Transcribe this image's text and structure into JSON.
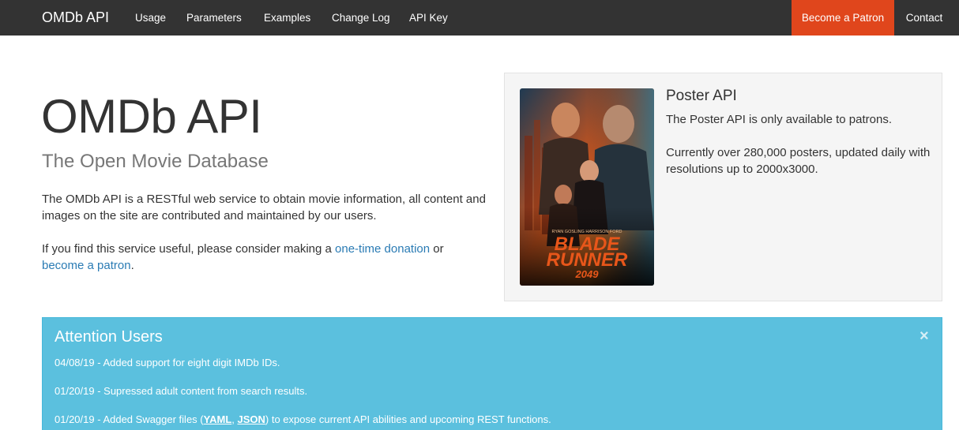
{
  "navbar": {
    "brand": "OMDb API",
    "links": [
      "Usage",
      "Parameters",
      "Examples",
      "Change Log",
      "API Key"
    ],
    "patron_button": "Become a Patron",
    "contact": "Contact",
    "colors": {
      "background": "#333333",
      "patron": "#e0461c"
    }
  },
  "hero": {
    "title": "OMDb API",
    "subtitle": "The Open Movie Database",
    "paragraph1": "The OMDb API is a RESTful web service to obtain movie information, all content and images on the site are contributed and maintained by our users.",
    "paragraph2_prefix": "If you find this service useful, please consider making a ",
    "donation_link": "one-time donation",
    "paragraph2_middle": " or",
    "patron_link": "become a patron",
    "paragraph2_suffix": "."
  },
  "poster": {
    "heading": "Poster API",
    "line1": "The Poster API is only available to patrons.",
    "line2": "Currently over 280,000 posters, updated daily with resolutions up to 2000x3000.",
    "image": {
      "actors": "RYAN GOSLING    HARRISON FORD",
      "title_line1": "BLADE",
      "title_line2": "RUNNER",
      "title_line3": "2049"
    }
  },
  "alert": {
    "title": "Attention Users",
    "close": "×",
    "item1": "04/08/19 - Added support for eight digit IMDb IDs.",
    "item2": "01/20/19 - Supressed adult content from search results.",
    "item3_prefix": "01/20/19 - Added Swagger files (",
    "item3_yaml": "YAML",
    "item3_sep": ", ",
    "item3_json": "JSON",
    "item3_suffix": ") to expose current API abilities and upcoming REST functions.",
    "colors": {
      "background": "#5bc0de"
    }
  }
}
